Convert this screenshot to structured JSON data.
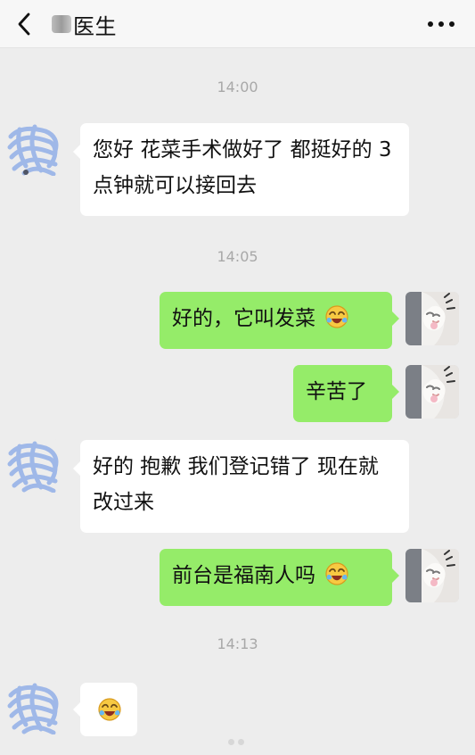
{
  "header": {
    "title": "医生"
  },
  "messages": {
    "time_1": "14:00",
    "time_2": "14:05",
    "time_3": "14:13",
    "left_1": "您好 花菜手术做好了 都挺好的 3 点钟就可以接回去",
    "right_1": "好的，它叫发菜",
    "right_2": "辛苦了",
    "left_2": "好的  抱歉 我们登记错了 现在就改过来",
    "right_3": "前台是福南人吗"
  },
  "icons": {
    "back": "chevron-left-icon",
    "more": "more-horizontal-icon",
    "emoji": "laughing-crying-emoji-icon"
  },
  "colors": {
    "background": "#ededed",
    "incoming_bubble": "#ffffff",
    "outgoing_bubble": "#95ec69",
    "time_text": "#a8a8a8"
  }
}
